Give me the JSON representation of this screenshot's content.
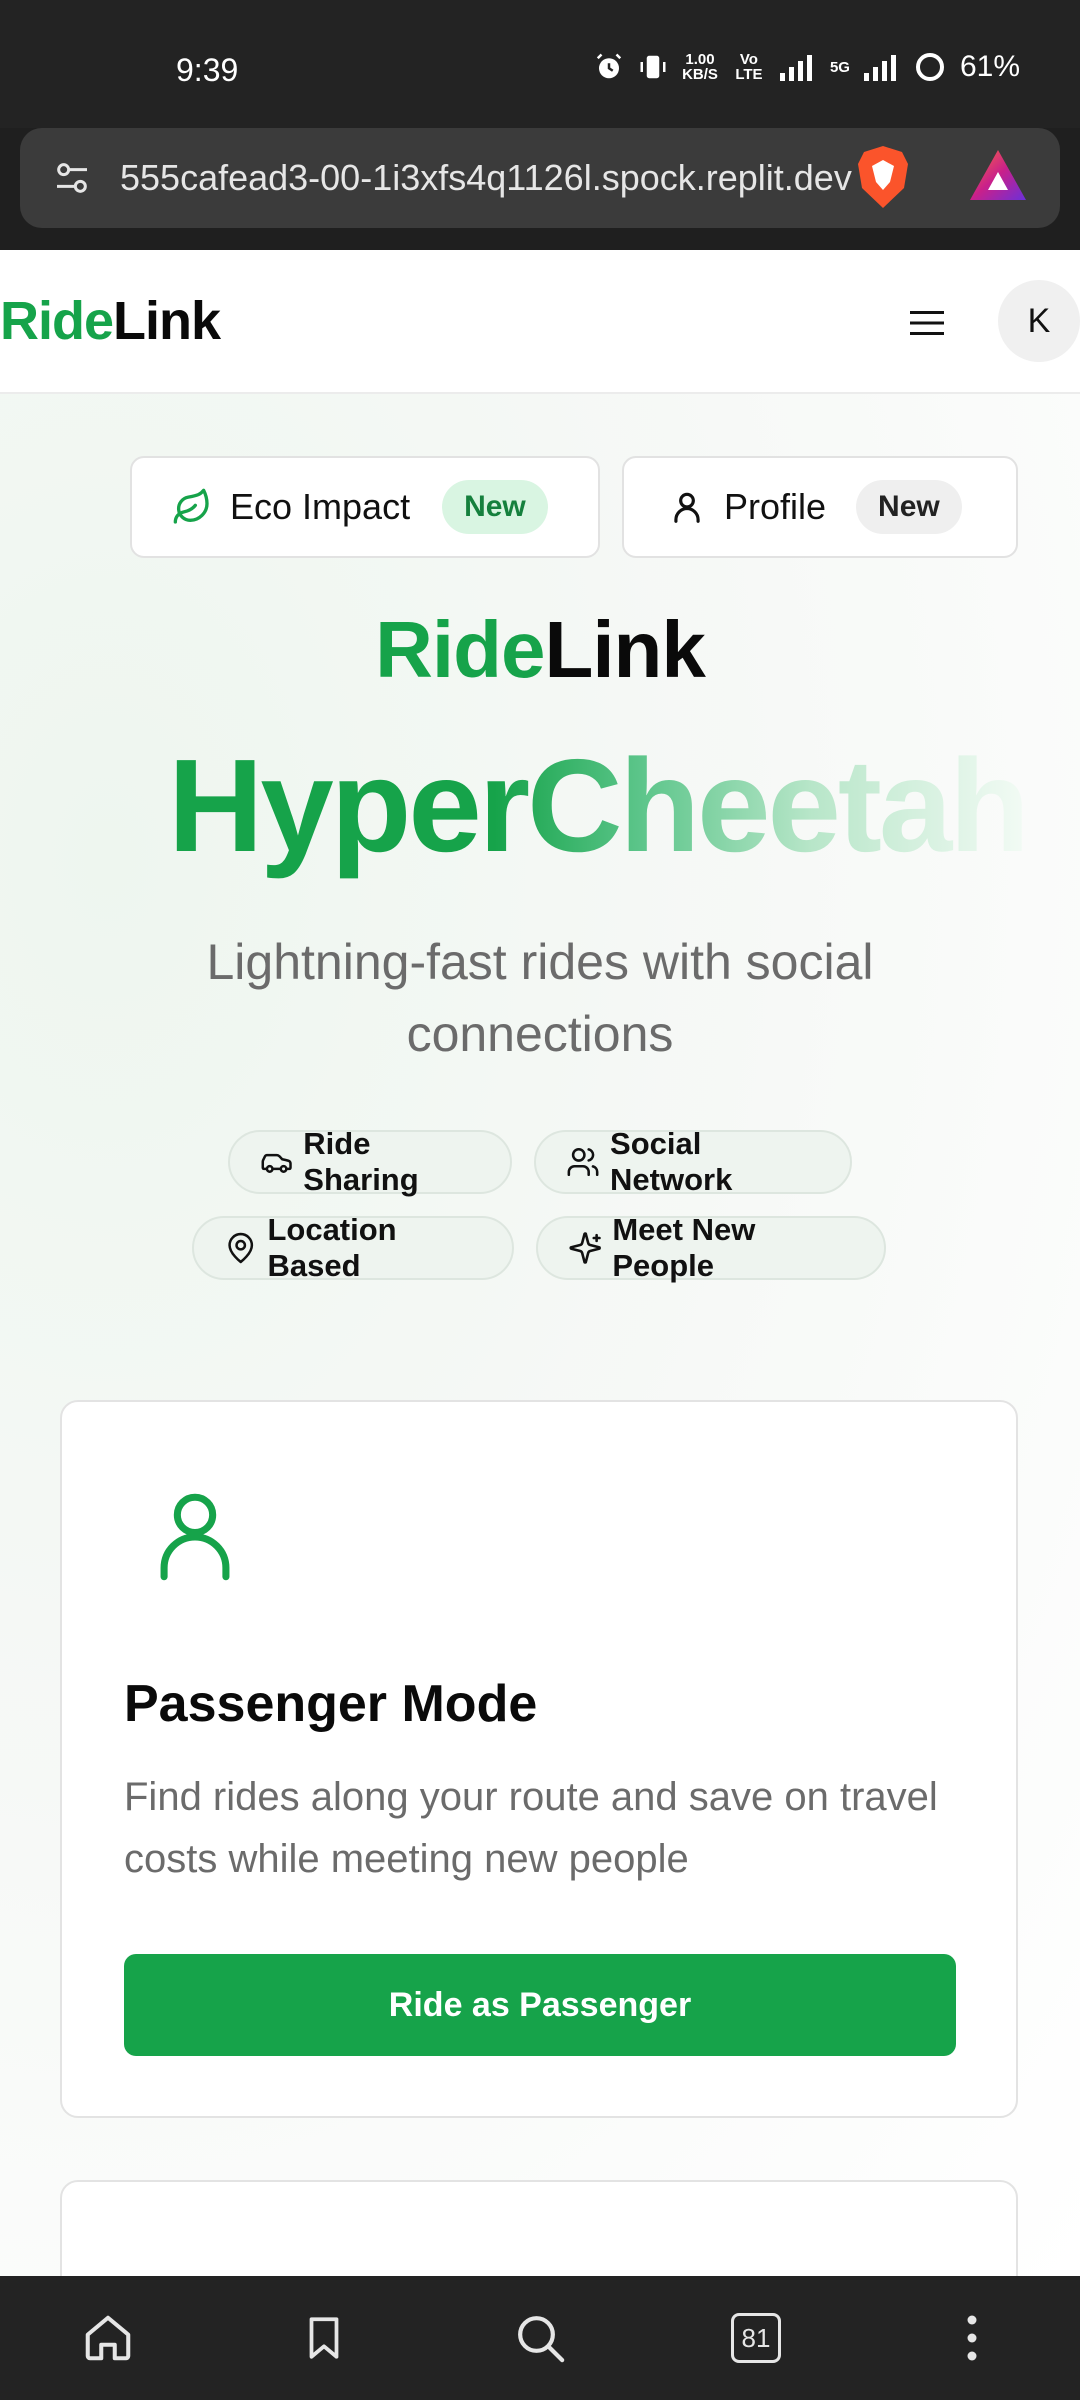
{
  "status_bar": {
    "time": "9:39",
    "net_speed": "1.00",
    "net_unit": "KB/S",
    "volte": "Vo LTE",
    "network": "5G",
    "battery": "61%"
  },
  "browser": {
    "url": "555cafead3-00-1i3xfs4q1126l.spock.replit.dev",
    "tab_count": "81"
  },
  "header": {
    "brand_part1": "Ride",
    "brand_part2": "Link",
    "avatar_initial": "K"
  },
  "top_buttons": [
    {
      "label": "Eco Impact",
      "badge": "New"
    },
    {
      "label": "Profile",
      "badge": "New"
    }
  ],
  "hero": {
    "brand_part1": "Ride",
    "brand_part2": "Link",
    "title": "HyperCheetah",
    "subtitle": "Lightning-fast rides with social connections"
  },
  "chips": [
    {
      "label": "Ride Sharing",
      "icon": "car-icon"
    },
    {
      "label": "Social Network",
      "icon": "users-icon"
    },
    {
      "label": "Location Based",
      "icon": "map-pin-icon"
    },
    {
      "label": "Meet New People",
      "icon": "sparkles-icon"
    }
  ],
  "cards": [
    {
      "title": "Passenger Mode",
      "description": "Find rides along your route and save on travel costs while meeting new people",
      "button": "Ride as Passenger"
    }
  ],
  "colors": {
    "brand_green": "#16a34a",
    "badge_green_bg": "#d9f5e2",
    "text_muted": "#6b6b6b"
  }
}
